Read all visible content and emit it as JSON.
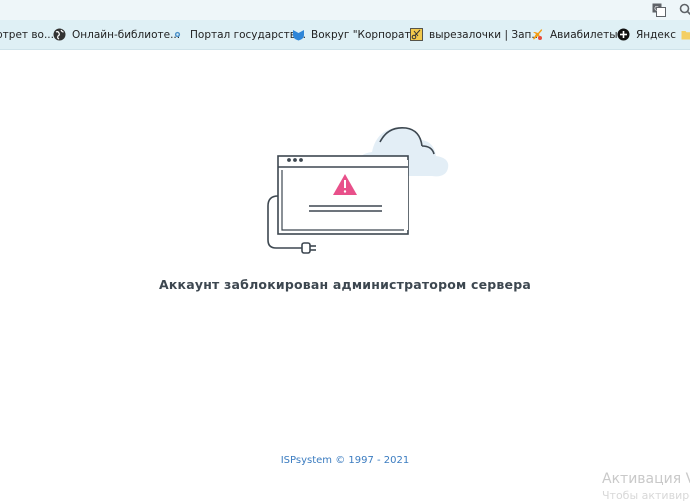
{
  "browser": {
    "bookmarks": [
      {
        "label": "ртрет во...",
        "icon": "page-icon"
      },
      {
        "label": "Онлайн-библиоте...",
        "icon": "globe-icon"
      },
      {
        "label": "Портал государств...",
        "icon": "gov-portal-icon"
      },
      {
        "label": "Вокруг \"Корпорат...",
        "icon": "shield-icon"
      },
      {
        "label": "вырезалочки | Зап...",
        "icon": "scissors-icon"
      },
      {
        "label": "Авиабилеты",
        "icon": "plane-icon"
      },
      {
        "label": "Яндекс",
        "icon": "yandex-icon"
      }
    ],
    "top_icons": [
      "translate-icon",
      "search-icon"
    ]
  },
  "page": {
    "message": "Аккаунт заблокирован администратором сервера",
    "footer": "ISPsystem © 1997 - 2021",
    "illustration_icon": "disconnected-window-warning-icon"
  },
  "os_overlay": {
    "activation_title": "Активация V",
    "activation_subtitle": "Чтобы активиро"
  },
  "colors": {
    "accent_warning": "#e8508a",
    "line_color": "#3d4750",
    "cloud_fill": "#e3eef6",
    "bookmark_bar": "#dff0f5",
    "footer_link": "#3b7cc0"
  }
}
